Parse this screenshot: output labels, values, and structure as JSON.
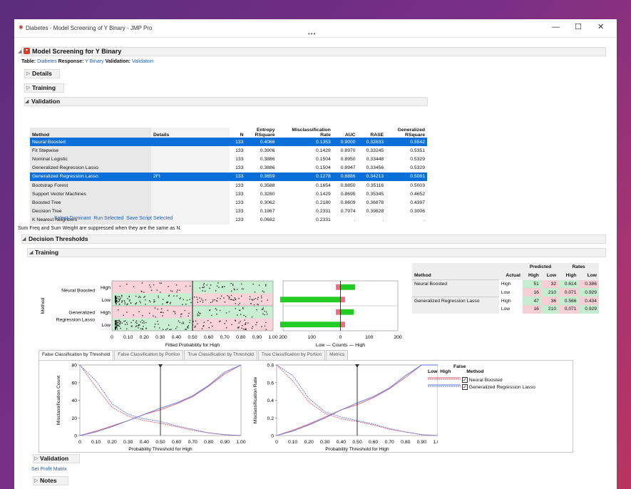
{
  "window": {
    "title": "Diabetes - Model Screening of Y Binary - JMP Pro",
    "minimize": "—",
    "maximize": "☐",
    "close": "✕",
    "more": "•••"
  },
  "report": {
    "title": "Model Screening for Y Binary",
    "table_label": "Table:",
    "table_value": "Diabetes",
    "response_label": "Response:",
    "response_value": "Y Binary",
    "validation_label": "Validation:",
    "validation_value": "Validation",
    "details": "Details",
    "training": "Training",
    "validation": "Validation"
  },
  "validation_table": {
    "headers": {
      "method": "Method",
      "details": "Details",
      "n": "N",
      "entropy_top": "Entropy",
      "entropy_bottom": "RSquare",
      "misclass_top": "Misclassification",
      "misclass_bottom": "Rate",
      "auc": "AUC",
      "rase": "RASE",
      "gen_top": "Generalized",
      "gen_bottom": "RSquare"
    },
    "rows": [
      {
        "method": "Neural Boosted",
        "details": "",
        "n": "133",
        "entropy": "0.4066",
        "misclass": "0.1353",
        "auc": "0.9000",
        "rase": "0.32833",
        "gen": "0.5542",
        "selected": true
      },
      {
        "method": "Fit Stepwise",
        "details": "",
        "n": "133",
        "entropy": "0.3906",
        "misclass": "0.1429",
        "auc": "0.8970",
        "rase": "0.33245",
        "gen": "0.5351",
        "selected": false
      },
      {
        "method": "Nominal Logistic",
        "details": "",
        "n": "133",
        "entropy": "0.3886",
        "misclass": "0.1504",
        "auc": "0.8950",
        "rase": "0.33448",
        "gen": "0.5329",
        "selected": false
      },
      {
        "method": "Generalized Regression Lasso",
        "details": "",
        "n": "133",
        "entropy": "0.3886",
        "misclass": "0.1504",
        "auc": "0.8947",
        "rase": "0.33456",
        "gen": "0.5329",
        "selected": false
      },
      {
        "method": "Generalized Regression Lasso",
        "details": "2FI",
        "n": "133",
        "entropy": "0.3659",
        "misclass": "0.1278",
        "auc": "0.8886",
        "rase": "0.34213",
        "gen": "0.5081",
        "selected": true
      },
      {
        "method": "Bootstrap Forest",
        "details": "",
        "n": "133",
        "entropy": "0.3588",
        "misclass": "0.1654",
        "auc": "0.8850",
        "rase": "0.35116",
        "gen": "0.5003",
        "selected": false
      },
      {
        "method": "Support Vector Machines",
        "details": "",
        "n": "133",
        "entropy": "0.3280",
        "misclass": "0.1429",
        "auc": "0.8695",
        "rase": "0.35345",
        "gen": "0.4652",
        "selected": false
      },
      {
        "method": "Boosted Tree",
        "details": "",
        "n": "133",
        "entropy": "0.3062",
        "misclass": "0.2180",
        "auc": "0.8609",
        "rase": "0.36878",
        "gen": "0.4397",
        "selected": false
      },
      {
        "method": "Decision Tree",
        "details": "",
        "n": "133",
        "entropy": "0.1967",
        "misclass": "0.2331",
        "auc": "0.7974",
        "rase": "0.39828",
        "gen": "0.3006",
        "selected": false
      },
      {
        "method": "K Nearest Neighbors",
        "details": "",
        "n": "133",
        "entropy": "0.0682",
        "misclass": "0.2331",
        "auc": ".",
        "rase": ".",
        "gen": ".",
        "selected": false
      }
    ]
  },
  "links": {
    "select_dominant": "Select Dominant",
    "run_selected": "Run Selected",
    "save_script": "Save Script Selected"
  },
  "note": "Sum Freq and Sum Weight are suppressed when they are the same as N.",
  "decision": {
    "title": "Decision Thresholds",
    "training": "Training",
    "method_axis": "Method",
    "model1": "Neural Boosted",
    "model2a": "Generalized",
    "model2b": "Regression Lasso",
    "high": "High",
    "low": "Low",
    "x_ticks": [
      "0",
      "0.10",
      "0.20",
      "0.30",
      "0.40",
      "0.50",
      "0.60",
      "0.70",
      "0.80",
      "0.90",
      "1.00"
    ],
    "x_label": "Fitted Probability for High",
    "threshold_label": "Probability Threshold:",
    "threshold_value": "0.5",
    "count_ticks": [
      "200",
      "100",
      "0",
      "100",
      "200"
    ],
    "count_label": "Low — Counts — High",
    "bars": [
      {
        "row": "Neural Boosted High",
        "left": 16,
        "right": 51
      },
      {
        "row": "Neural Boosted Low",
        "left": 210,
        "right": 16
      },
      {
        "row": "Generalized Regression Lasso High",
        "left": 16,
        "right": 47
      },
      {
        "row": "Generalized Regression Lasso Low",
        "left": 210,
        "right": 16
      }
    ]
  },
  "predicted_table": {
    "predicted": "Predicted",
    "rates": "Rates",
    "method": "Method",
    "actual": "Actual",
    "high": "High",
    "low": "Low",
    "rows": [
      {
        "method": "Neural Boosted",
        "actual": "High",
        "ph": "51",
        "pl": "32",
        "rh": "0.614",
        "rl": "0.386"
      },
      {
        "method": "",
        "actual": "Low",
        "ph": "16",
        "pl": "210",
        "rh": "0.071",
        "rl": "0.929"
      },
      {
        "method": "Generalized Regression Lasso",
        "actual": "High",
        "ph": "47",
        "pl": "36",
        "rh": "0.566",
        "rl": "0.434"
      },
      {
        "method": "",
        "actual": "Low",
        "ph": "16",
        "pl": "210",
        "rh": "0.071",
        "rl": "0.929"
      }
    ]
  },
  "tabs": [
    "False Classification by Threshold",
    "False Classification by Portion",
    "True Classification by Threshold",
    "True Classification by Portion",
    "Metrics"
  ],
  "chart_data": [
    {
      "type": "line",
      "ylabel": "Misclassification Count",
      "xlabel": "Probability Threshold for High",
      "x": [
        0,
        0.1,
        0.2,
        0.3,
        0.4,
        0.5,
        0.6,
        0.7,
        0.8,
        0.9,
        1.0
      ],
      "xlim": [
        0,
        1
      ],
      "ylim": [
        0,
        80
      ],
      "y_ticks": [
        "0",
        "20",
        "40",
        "60",
        "80"
      ],
      "x_ticks": [
        "0",
        "0.10",
        "0.20",
        "0.30",
        "0.40",
        "0.50",
        "0.60",
        "0.70",
        "0.80",
        "0.90",
        "1.00"
      ],
      "threshold": 0.5,
      "series": [
        {
          "name": "Neural Boosted",
          "low": [
            95,
            55,
            32,
            22,
            17,
            14,
            10,
            6,
            3,
            1,
            0
          ],
          "high": [
            0,
            5,
            11,
            17,
            24,
            29,
            36,
            44,
            56,
            70,
            83
          ]
        },
        {
          "name": "Generalized Regression Lasso",
          "low": [
            98,
            62,
            36,
            24,
            19,
            16,
            11,
            7,
            3,
            1,
            0
          ],
          "high": [
            0,
            4,
            10,
            17,
            24,
            31,
            37,
            45,
            57,
            72,
            83
          ]
        }
      ]
    },
    {
      "type": "line",
      "ylabel": "Misclassification Rate",
      "xlabel": "Probability Threshold for High",
      "x": [
        0,
        0.1,
        0.2,
        0.3,
        0.4,
        0.5,
        0.6,
        0.7,
        0.8,
        0.9,
        1.0
      ],
      "xlim": [
        0,
        1
      ],
      "ylim": [
        0,
        0.8
      ],
      "y_ticks": [
        "0",
        "0.2",
        "0.4",
        "0.6",
        "0.8"
      ],
      "x_ticks": [
        "0",
        "0.10",
        "0.20",
        "0.30",
        "0.40",
        "0.50",
        "0.60",
        "0.70",
        "0.80",
        "0.90",
        "1.00"
      ],
      "threshold": 0.5,
      "series": [
        {
          "name": "Neural Boosted",
          "low": [
            1.0,
            0.62,
            0.38,
            0.25,
            0.19,
            0.16,
            0.12,
            0.07,
            0.04,
            0.01,
            0
          ],
          "high": [
            0,
            0.06,
            0.13,
            0.21,
            0.29,
            0.35,
            0.43,
            0.53,
            0.66,
            0.8,
            0.95
          ]
        },
        {
          "name": "Generalized Regression Lasso",
          "low": [
            1.0,
            0.68,
            0.42,
            0.27,
            0.21,
            0.17,
            0.13,
            0.08,
            0.04,
            0.01,
            0
          ],
          "high": [
            0,
            0.05,
            0.12,
            0.2,
            0.29,
            0.37,
            0.44,
            0.54,
            0.68,
            0.82,
            0.95
          ]
        }
      ]
    }
  ],
  "legend": {
    "false": "False",
    "low": "Low",
    "high": "High",
    "method": "Method",
    "items": [
      "Neural Boosted",
      "Generalized Regression Lasso"
    ],
    "check": "✓"
  },
  "footer": {
    "validation": "Validation",
    "profit": "Set Profit Matrix",
    "notes": "Notes"
  },
  "colors": {
    "selection": "#0a6fd8",
    "link": "#1f5fbf",
    "green": "#22cc22",
    "pink": "#f06a8a",
    "red_line": "#e05a6a",
    "blue_line": "#5a74e6"
  }
}
